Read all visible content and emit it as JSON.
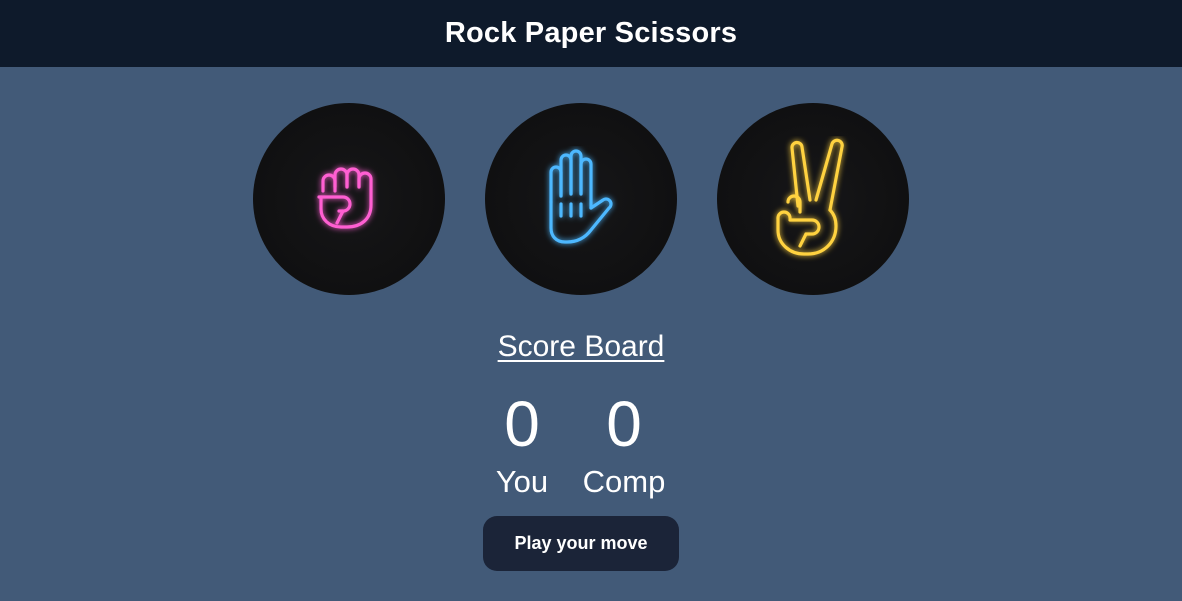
{
  "header": {
    "title": "Rock Paper Scissors"
  },
  "choices": [
    {
      "name": "rock",
      "icon": "fist-icon",
      "color": "#ff5fd2"
    },
    {
      "name": "paper",
      "icon": "open-hand-icon",
      "color": "#4db8ff"
    },
    {
      "name": "scissors",
      "icon": "peace-sign-icon",
      "color": "#ffd23f"
    }
  ],
  "scoreboard": {
    "title": "Score Board",
    "you": {
      "score": "0",
      "label": "You"
    },
    "comp": {
      "score": "0",
      "label": "Comp"
    }
  },
  "play_button": {
    "label": "Play your move"
  }
}
